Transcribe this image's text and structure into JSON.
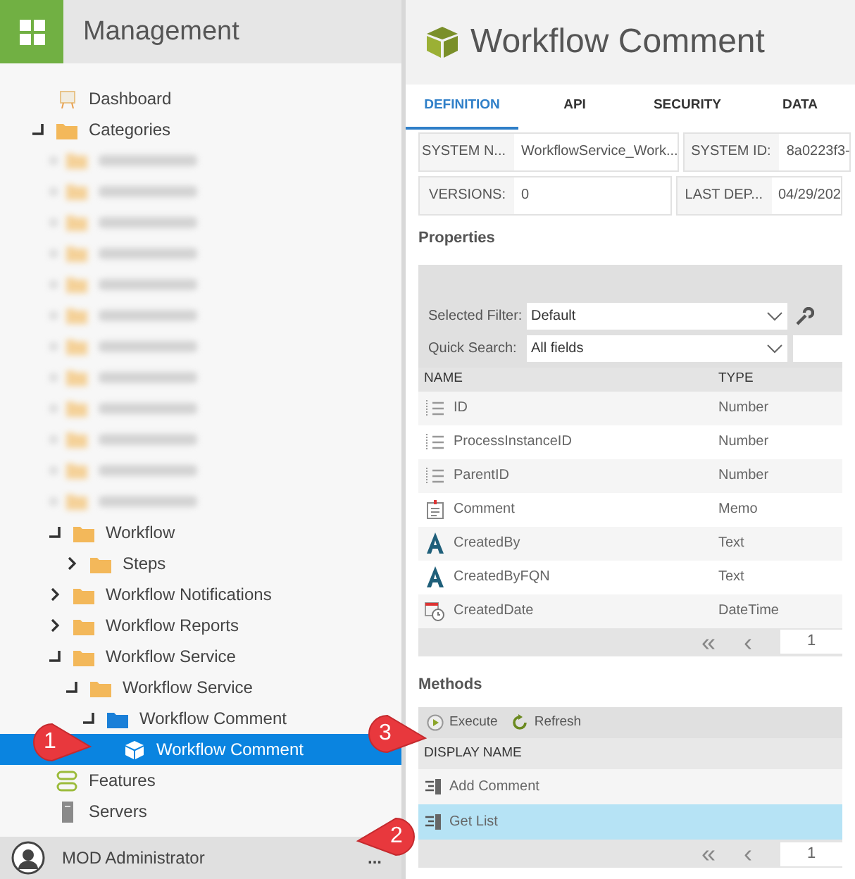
{
  "sidebar": {
    "title": "Management",
    "tree": [
      {
        "label": "Dashboard",
        "kind": "dashboard"
      },
      {
        "label": "Categories",
        "kind": "folder",
        "expanded": true,
        "children": [
          {
            "kind": "blurred"
          },
          {
            "kind": "blurred"
          },
          {
            "kind": "blurred"
          },
          {
            "kind": "blurred"
          },
          {
            "kind": "blurred"
          },
          {
            "kind": "blurred"
          },
          {
            "kind": "blurred"
          },
          {
            "kind": "blurred"
          },
          {
            "kind": "blurred"
          },
          {
            "kind": "blurred"
          },
          {
            "kind": "blurred"
          },
          {
            "kind": "blurred"
          },
          {
            "label": "Workflow",
            "kind": "folder",
            "expanded": true,
            "children": [
              {
                "label": "Steps",
                "kind": "folder",
                "expanded": false
              }
            ]
          },
          {
            "label": "Workflow Notifications",
            "kind": "folder",
            "expanded": false
          },
          {
            "label": "Workflow Reports",
            "kind": "folder",
            "expanded": false
          },
          {
            "label": "Workflow Service",
            "kind": "folder",
            "expanded": true,
            "children": [
              {
                "label": "Workflow Service",
                "kind": "folder",
                "expanded": true,
                "children": [
                  {
                    "label": "Workflow Comment",
                    "kind": "folder_blue",
                    "expanded": true,
                    "children": [
                      {
                        "label": "Workflow Comment",
                        "kind": "cube",
                        "selected": true
                      }
                    ]
                  }
                ]
              }
            ]
          }
        ]
      },
      {
        "label": "Features",
        "kind": "features"
      },
      {
        "label": "Servers",
        "kind": "servers"
      }
    ],
    "user": {
      "name": "MOD Administrator",
      "menu": "..."
    }
  },
  "header": {
    "title": "Workflow Comment"
  },
  "tabs": [
    {
      "label": "DEFINITION",
      "selected": true
    },
    {
      "label": "API",
      "selected": false
    },
    {
      "label": "SECURITY",
      "selected": false
    },
    {
      "label": "DATA",
      "selected": false
    }
  ],
  "info": [
    {
      "label": "SYSTEM N...",
      "value": "WorkflowService_Work..."
    },
    {
      "label": "SYSTEM ID:",
      "value": "8a0223f3-"
    },
    {
      "label": "VERSIONS:",
      "value": "0"
    },
    {
      "label": "LAST DEP...",
      "value": "04/29/202"
    }
  ],
  "properties": {
    "title": "Properties",
    "filter_label": "Selected Filter:",
    "filter_value": "Default",
    "search_label": "Quick Search:",
    "search_value": "All fields",
    "columns": [
      "NAME",
      "TYPE"
    ],
    "rows": [
      {
        "name": "ID",
        "type": "Number",
        "kind": "number"
      },
      {
        "name": "ProcessInstanceID",
        "type": "Number",
        "kind": "number"
      },
      {
        "name": "ParentID",
        "type": "Number",
        "kind": "number"
      },
      {
        "name": "Comment",
        "type": "Memo",
        "kind": "memo"
      },
      {
        "name": "CreatedBy",
        "type": "Text",
        "kind": "text"
      },
      {
        "name": "CreatedByFQN",
        "type": "Text",
        "kind": "text"
      },
      {
        "name": "CreatedDate",
        "type": "DateTime",
        "kind": "datetime"
      }
    ],
    "pager": {
      "first": "«",
      "prev": "‹",
      "page": "1"
    }
  },
  "methods": {
    "title": "Methods",
    "execute": "Execute",
    "refresh": "Refresh",
    "columns": [
      "DISPLAY NAME"
    ],
    "rows": [
      {
        "name": "Add Comment",
        "selected": false
      },
      {
        "name": "Get List",
        "selected": true
      }
    ],
    "pager": {
      "first": "«",
      "prev": "‹",
      "page": "1"
    }
  },
  "callouts": [
    {
      "label": "1",
      "kind": "tree"
    },
    {
      "label": "2",
      "kind": "row"
    },
    {
      "label": "3",
      "kind": "execute"
    }
  ]
}
